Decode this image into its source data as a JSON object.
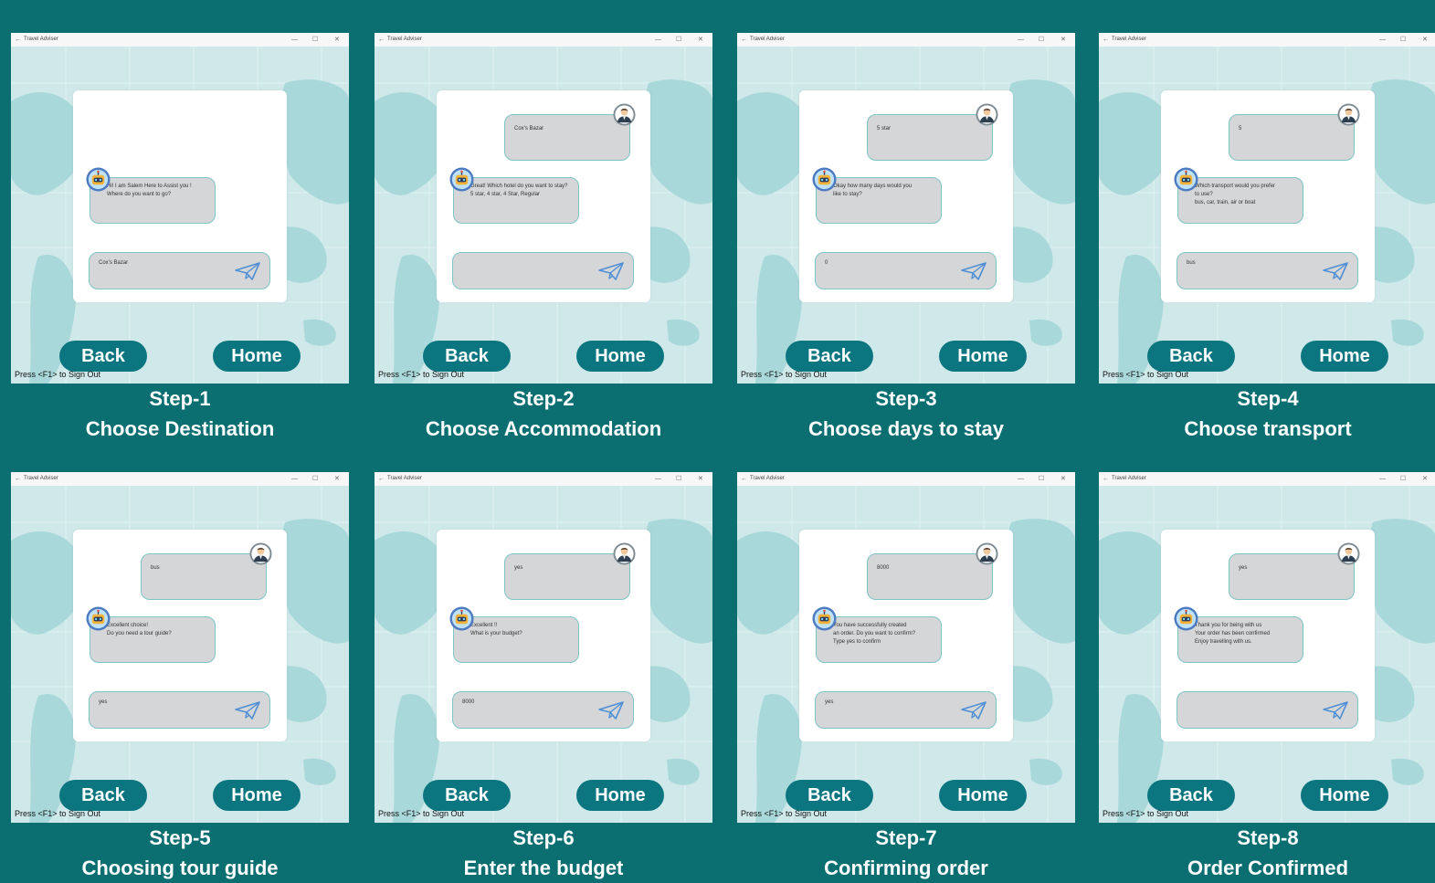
{
  "window": {
    "title": "Travel Adviser",
    "back_glyph": "←",
    "minimize_glyph": "—",
    "maximize_glyph": "☐",
    "close_glyph": "✕"
  },
  "buttons": {
    "back": "Back",
    "home": "Home"
  },
  "signout_hint": "Press <F1> to Sign Out",
  "colors": {
    "background": "#0b6f72",
    "button": "#0c7680",
    "bubble": "#d5d6d7",
    "bubble_border": "#7dc4c6",
    "map_land": "#a9d8da"
  },
  "icons": {
    "send": "paper-plane-icon",
    "user": "businessman-avatar-icon",
    "bot": "robot-avatar-icon",
    "back_arrow": "back-arrow-icon"
  },
  "steps": [
    {
      "step": "Step-1",
      "caption": "Choose Destination",
      "user_message": "",
      "bot_lines": [
        "Hi! I am Salem Here to Assist you !",
        "Where do you want to go?"
      ],
      "input_value": "Cox's Bazar"
    },
    {
      "step": "Step-2",
      "caption": "Choose Accommodation",
      "user_message": "Cox's Bazar",
      "bot_lines": [
        "Great! Which hotel do you want to stay?",
        "5 star, 4 star, 4 Star, Regular"
      ],
      "input_value": ""
    },
    {
      "step": "Step-3",
      "caption": "Choose days to stay",
      "user_message": "5 star",
      "bot_lines": [
        "Okay how many days would you",
        "like to stay?"
      ],
      "input_value": "0"
    },
    {
      "step": "Step-4",
      "caption": "Choose transport",
      "user_message": "5",
      "bot_lines": [
        "Which transport would you prefer",
        "to use?",
        "bus, car, train, air or boat"
      ],
      "input_value": "bus"
    },
    {
      "step": "Step-5",
      "caption": "Choosing tour guide",
      "user_message": "bus",
      "bot_lines": [
        "Excellent choice!",
        "Do you need a tour guide?"
      ],
      "input_value": "yes"
    },
    {
      "step": "Step-6",
      "caption": "Enter the budget",
      "user_message": "yes",
      "bot_lines": [
        "Excellent !!",
        "What is your budget?"
      ],
      "input_value": "8000"
    },
    {
      "step": "Step-7",
      "caption": "Confirming order",
      "user_message": "8000",
      "bot_lines": [
        "You have successfully created",
        "an order. Do you want to confirm?",
        "Type yes to confirm"
      ],
      "input_value": "yes"
    },
    {
      "step": "Step-8",
      "caption": "Order Confirmed",
      "user_message": "yes",
      "bot_lines": [
        "Thank you for being with us",
        "Your order has been confirmed",
        "Enjoy travelling with us."
      ],
      "input_value": ""
    }
  ]
}
